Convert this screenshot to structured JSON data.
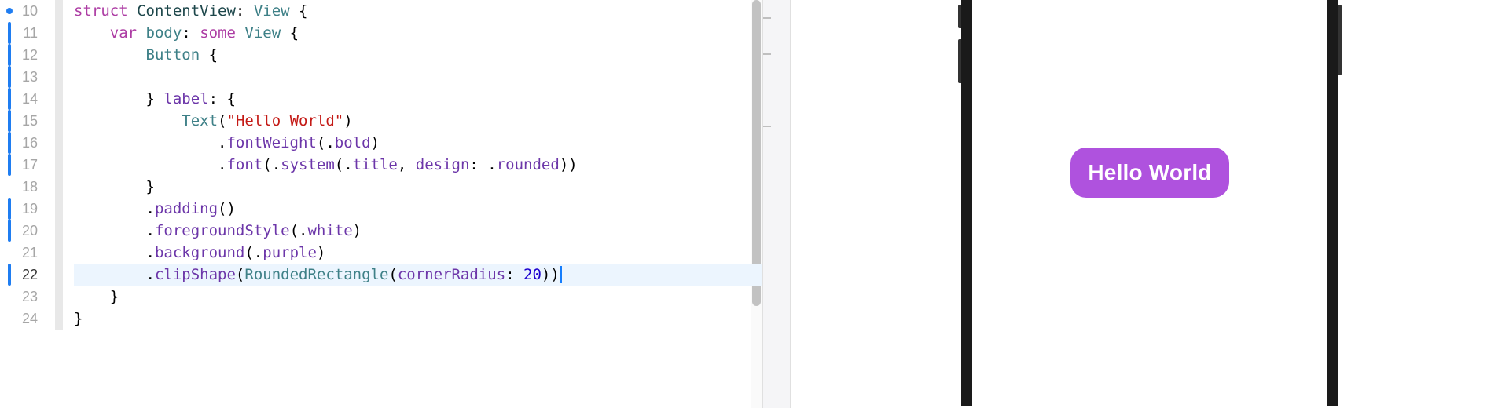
{
  "editor": {
    "lines": [
      {
        "num": "10",
        "indent": 0,
        "marker": "dot",
        "current": false,
        "highlight": false,
        "tokens": [
          {
            "t": "struct ",
            "c": "kw-struct"
          },
          {
            "t": "ContentView",
            "c": "type-user"
          },
          {
            "t": ": ",
            "c": "punct"
          },
          {
            "t": "View",
            "c": "type"
          },
          {
            "t": " {",
            "c": "punct"
          }
        ]
      },
      {
        "num": "11",
        "indent": 1,
        "marker": "bar",
        "current": false,
        "highlight": false,
        "tokens": [
          {
            "t": "var ",
            "c": "kw-var"
          },
          {
            "t": "body",
            "c": "ident"
          },
          {
            "t": ": ",
            "c": "punct"
          },
          {
            "t": "some ",
            "c": "kw-some"
          },
          {
            "t": "View",
            "c": "type"
          },
          {
            "t": " {",
            "c": "punct"
          }
        ]
      },
      {
        "num": "12",
        "indent": 2,
        "marker": "bar",
        "current": false,
        "highlight": false,
        "tokens": [
          {
            "t": "Button",
            "c": "type"
          },
          {
            "t": " {",
            "c": "punct"
          }
        ]
      },
      {
        "num": "13",
        "indent": 3,
        "marker": "bar",
        "current": false,
        "highlight": false,
        "tokens": []
      },
      {
        "num": "14",
        "indent": 2,
        "marker": "bar",
        "current": false,
        "highlight": false,
        "tokens": [
          {
            "t": "} ",
            "c": "punct"
          },
          {
            "t": "label",
            "c": "param"
          },
          {
            "t": ": {",
            "c": "punct"
          }
        ]
      },
      {
        "num": "15",
        "indent": 3,
        "marker": "bar",
        "current": false,
        "highlight": false,
        "tokens": [
          {
            "t": "Text",
            "c": "type"
          },
          {
            "t": "(",
            "c": "punct"
          },
          {
            "t": "\"Hello World\"",
            "c": "string"
          },
          {
            "t": ")",
            "c": "punct"
          }
        ]
      },
      {
        "num": "16",
        "indent": 4,
        "marker": "bar",
        "current": false,
        "highlight": false,
        "tokens": [
          {
            "t": ".",
            "c": "punct"
          },
          {
            "t": "fontWeight",
            "c": "method"
          },
          {
            "t": "(.",
            "c": "punct"
          },
          {
            "t": "bold",
            "c": "enum"
          },
          {
            "t": ")",
            "c": "punct"
          }
        ]
      },
      {
        "num": "17",
        "indent": 4,
        "marker": "bar",
        "current": false,
        "highlight": false,
        "tokens": [
          {
            "t": ".",
            "c": "punct"
          },
          {
            "t": "font",
            "c": "method"
          },
          {
            "t": "(.",
            "c": "punct"
          },
          {
            "t": "system",
            "c": "method"
          },
          {
            "t": "(.",
            "c": "punct"
          },
          {
            "t": "title",
            "c": "enum"
          },
          {
            "t": ", ",
            "c": "punct"
          },
          {
            "t": "design",
            "c": "param"
          },
          {
            "t": ": .",
            "c": "punct"
          },
          {
            "t": "rounded",
            "c": "enum"
          },
          {
            "t": "))",
            "c": "punct"
          }
        ]
      },
      {
        "num": "18",
        "indent": 2,
        "marker": "none",
        "current": false,
        "highlight": false,
        "tokens": [
          {
            "t": "}",
            "c": "punct"
          }
        ]
      },
      {
        "num": "19",
        "indent": 2,
        "marker": "bar2",
        "current": false,
        "highlight": false,
        "tokens": [
          {
            "t": ".",
            "c": "punct"
          },
          {
            "t": "padding",
            "c": "method"
          },
          {
            "t": "()",
            "c": "punct"
          }
        ]
      },
      {
        "num": "20",
        "indent": 2,
        "marker": "bar2",
        "current": false,
        "highlight": false,
        "tokens": [
          {
            "t": ".",
            "c": "punct"
          },
          {
            "t": "foregroundStyle",
            "c": "method"
          },
          {
            "t": "(.",
            "c": "punct"
          },
          {
            "t": "white",
            "c": "enum"
          },
          {
            "t": ")",
            "c": "punct"
          }
        ]
      },
      {
        "num": "21",
        "indent": 2,
        "marker": "none",
        "current": false,
        "highlight": false,
        "tokens": [
          {
            "t": ".",
            "c": "punct"
          },
          {
            "t": "background",
            "c": "method"
          },
          {
            "t": "(.",
            "c": "punct"
          },
          {
            "t": "purple",
            "c": "enum"
          },
          {
            "t": ")",
            "c": "punct"
          }
        ]
      },
      {
        "num": "22",
        "indent": 2,
        "marker": "bar",
        "current": true,
        "highlight": true,
        "cursor": true,
        "tokens": [
          {
            "t": ".",
            "c": "punct"
          },
          {
            "t": "clipShape",
            "c": "method"
          },
          {
            "t": "(",
            "c": "punct"
          },
          {
            "t": "RoundedRectangle",
            "c": "type"
          },
          {
            "t": "(",
            "c": "punct"
          },
          {
            "t": "cornerRadius",
            "c": "param"
          },
          {
            "t": ": ",
            "c": "punct"
          },
          {
            "t": "20",
            "c": "number"
          },
          {
            "t": "))",
            "c": "punct"
          }
        ]
      },
      {
        "num": "23",
        "indent": 1,
        "marker": "none",
        "current": false,
        "highlight": false,
        "tokens": [
          {
            "t": "}",
            "c": "punct"
          }
        ]
      },
      {
        "num": "24",
        "indent": 0,
        "marker": "none",
        "current": false,
        "highlight": false,
        "tokens": [
          {
            "t": "}",
            "c": "punct"
          }
        ]
      }
    ],
    "indent_unit": "    "
  },
  "preview": {
    "button_label": "Hello World",
    "button_bg": "#af52de",
    "button_fg": "#ffffff",
    "corner_radius": 20
  }
}
